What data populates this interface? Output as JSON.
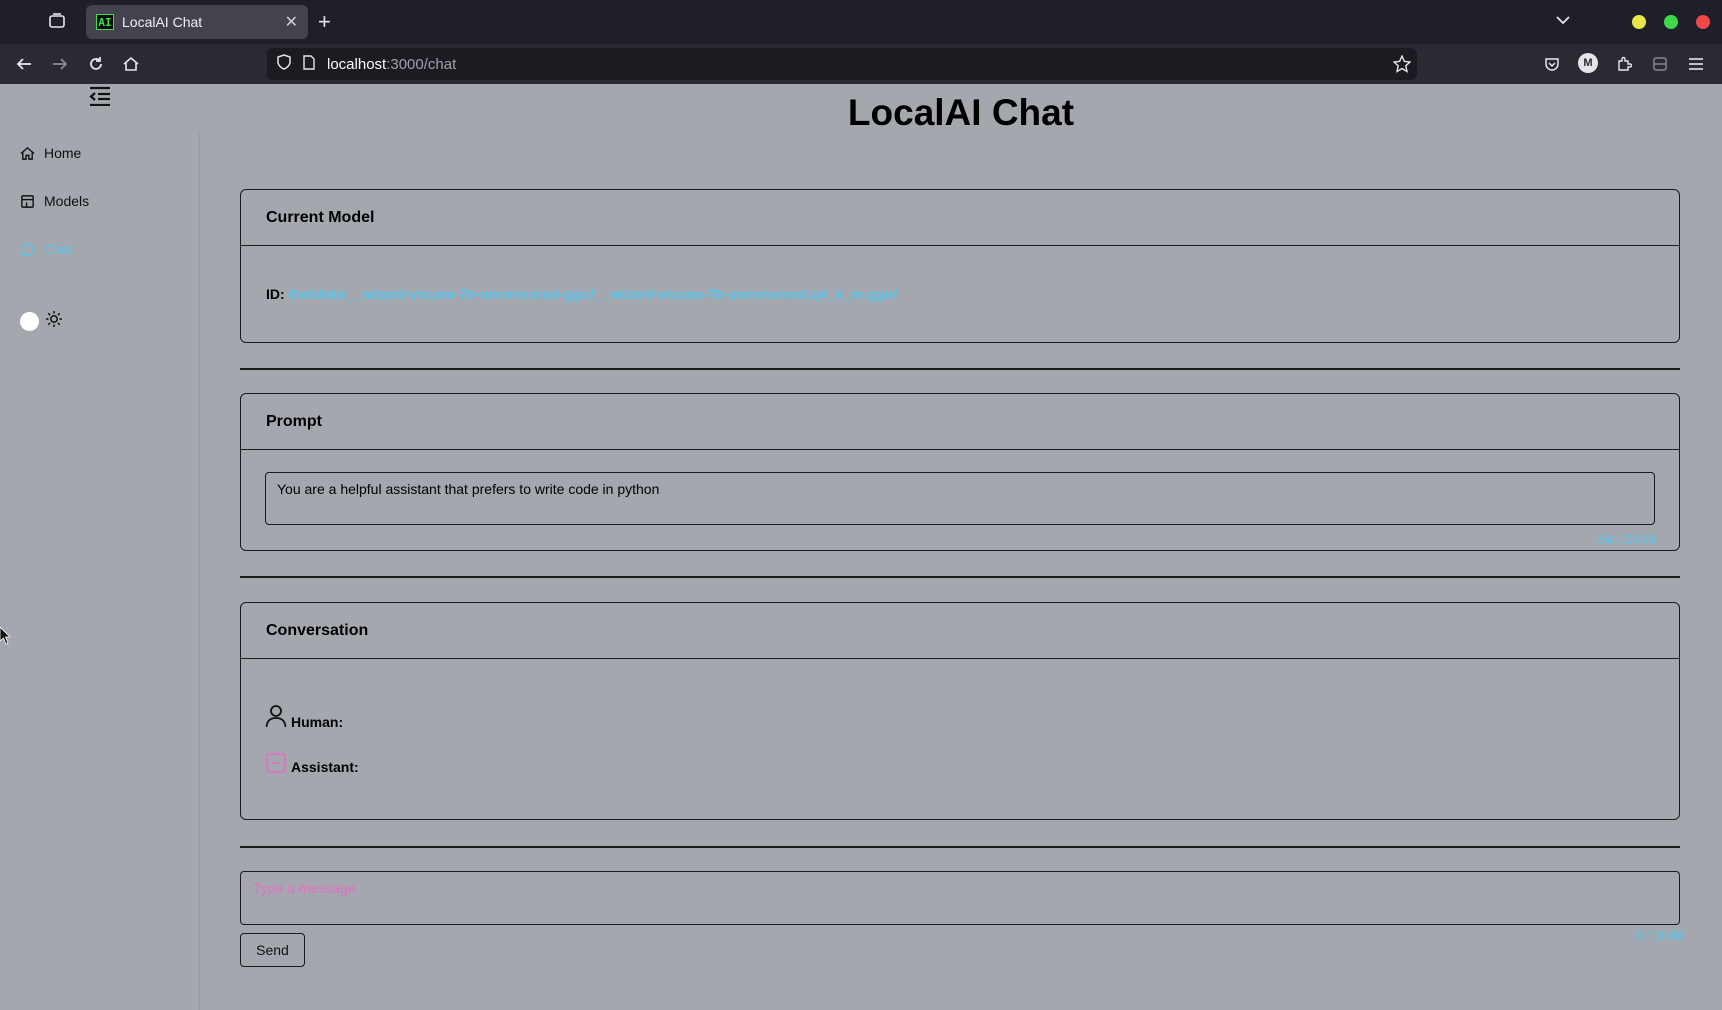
{
  "browser": {
    "tab_title": "LocalAI Chat",
    "favicon_text": "AI",
    "url_host": "localhost",
    "url_path": ":3000/chat",
    "profile_initial": "M"
  },
  "sidebar": {
    "items": [
      {
        "label": "Home",
        "icon": "home-icon"
      },
      {
        "label": "Models",
        "icon": "store-icon"
      },
      {
        "label": "Chat",
        "icon": "chat-bubble-icon",
        "active": true
      }
    ]
  },
  "main": {
    "title": "LocalAI Chat",
    "current_model": {
      "heading": "Current Model",
      "id_label": "ID:",
      "id_value": "thebloke__wizard-vicuna-7b-uncensored-gguf__wizard-vicuna-7b-uncensored.q4_k_m.gguf"
    },
    "prompt": {
      "heading": "Prompt",
      "value": "You are a helpful assistant that prefers to write code in python",
      "counter": "64 / 2048"
    },
    "conversation": {
      "heading": "Conversation",
      "human_label": "Human:",
      "assistant_label": "Assistant:"
    },
    "message": {
      "placeholder": "Type a message",
      "counter": "0 / 2048",
      "send_label": "Send"
    }
  },
  "colors": {
    "accent": "#59c6ec",
    "placeholder": "#e36ec8",
    "page_bg": "#a4a7ad"
  }
}
